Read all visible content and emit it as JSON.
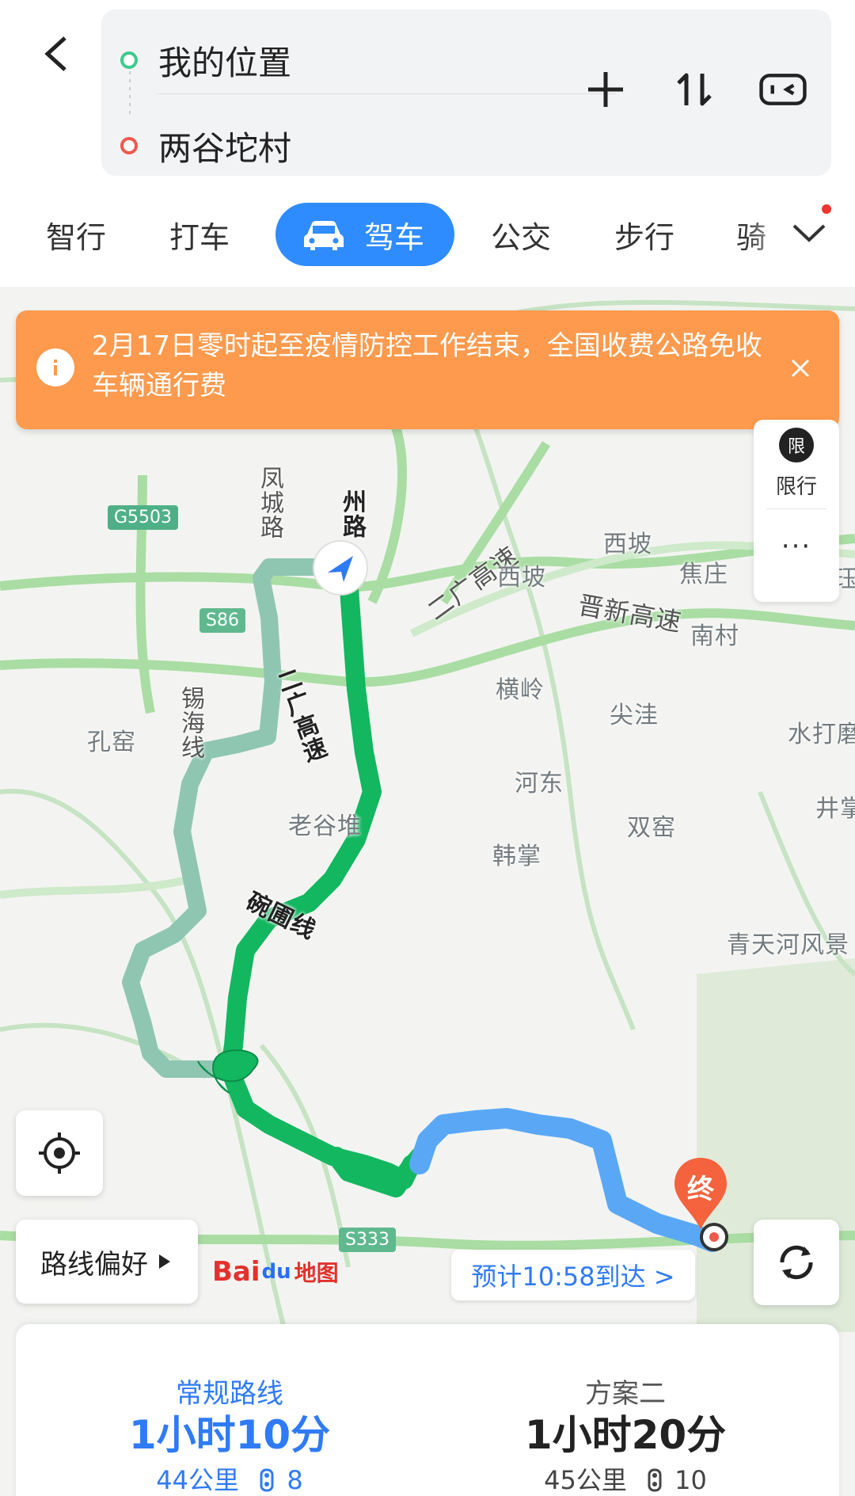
{
  "route": {
    "start": "我的位置",
    "end": "两谷坨村"
  },
  "icons": {
    "back": "chevron-left-icon",
    "add_stop": "plus-icon",
    "swap": "swap-icon",
    "mode_switch": "toggle-icon",
    "more_modes": "chevron-down-icon",
    "notice": "info-icon",
    "close": "close-icon",
    "limit": "restriction-icon",
    "locate": "locate-icon",
    "refresh": "refresh-icon",
    "end_marker": "destination-pin-icon"
  },
  "modes": [
    {
      "label": "智行"
    },
    {
      "label": "打车"
    },
    {
      "label": "驾车",
      "active": true
    },
    {
      "label": "公交"
    },
    {
      "label": "步行"
    },
    {
      "label": "骑"
    }
  ],
  "notice": {
    "text": "2月17日零时起至疫情防控工作结束，全国收费公路免收车辆通行费"
  },
  "side_panel": {
    "limit_icon_text": "限",
    "limit_label": "限行",
    "more": "···"
  },
  "map": {
    "places": [
      "西坡",
      "晋新高速",
      "二广高速",
      "西坡",
      "焦庄",
      "南村",
      "横岭",
      "尖洼",
      "孔窑",
      "水打磨",
      "河东",
      "井掌",
      "老谷堆",
      "双窑",
      "韩掌",
      "青天河风景",
      "凤城路",
      "锡海线",
      "州路",
      "二广高速",
      "碗圃线",
      "珏"
    ],
    "highway_badges": [
      "G5503",
      "S86",
      "S333"
    ],
    "end_label": "终",
    "logo": {
      "bai": "Bai",
      "du": "du",
      "ditu": "地图"
    }
  },
  "buttons": {
    "route_pref": "路线偏好",
    "eta": "预计10:58到达 >"
  },
  "plans": [
    {
      "name": "常规路线",
      "time": "1小时10分",
      "distance": "44公里",
      "lights": "8"
    },
    {
      "name": "方案二",
      "time": "1小时20分",
      "distance": "45公里",
      "lights": "10"
    }
  ],
  "colors": {
    "accent": "#2f8cff",
    "route_main": "#12b760",
    "route_alt": "#8fc6b2",
    "route_blue": "#5aa8f5",
    "notice": "#fd9a4d"
  }
}
